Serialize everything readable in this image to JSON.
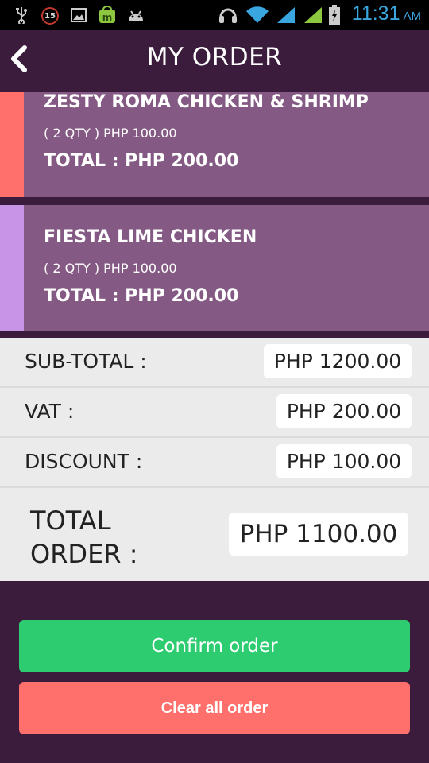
{
  "status_bar": {
    "notification_badge": "15",
    "time": "11:31",
    "ampm": "AM",
    "icons": [
      "usb-icon",
      "image-icon",
      "market-icon",
      "android-icon",
      "headset-icon",
      "wifi-icon",
      "signal-icon",
      "signal-icon",
      "battery-charging-icon"
    ]
  },
  "header": {
    "title": "MY ORDER",
    "back_icon": "chevron-left-icon"
  },
  "orders": [
    {
      "name": "ZESTY ROMA CHICKEN & SHRIMP",
      "qty_line": "( 2 QTY ) PHP 100.00",
      "total_line": "TOTAL : PHP 200.00",
      "stripe_color": "#ff6f6b"
    },
    {
      "name": "FIESTA LIME CHICKEN",
      "qty_line": "( 2 QTY ) PHP 100.00",
      "total_line": "TOTAL : PHP 200.00",
      "stripe_color": "#c894e8"
    }
  ],
  "summary": {
    "subtotal_label": "SUB-TOTAL :",
    "subtotal_value": "PHP 1200.00",
    "vat_label": "VAT :",
    "vat_value": "PHP 200.00",
    "discount_label": "DISCOUNT :",
    "discount_value": "PHP 100.00",
    "total_label": "TOTAL ORDER :",
    "total_value": "PHP 1100.00"
  },
  "buttons": {
    "confirm": "Confirm order",
    "clear": "Clear all order"
  },
  "colors": {
    "background": "#3b1c3d",
    "item_bg": "#845a84",
    "confirm": "#2ecc71",
    "clear": "#ff6f6b",
    "summary_bg": "#ebebeb",
    "time": "#3aa6e0"
  }
}
